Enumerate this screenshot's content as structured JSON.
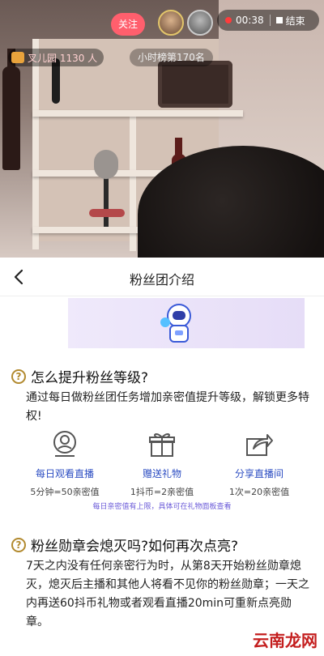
{
  "live": {
    "follow_label": "关注",
    "rec_time": "00:38",
    "end_label": "结束",
    "fan_club_count": "叉儿园 1130 人",
    "hour_rank": "小时榜第170名"
  },
  "sheet": {
    "title": "粉丝团介绍",
    "section1": {
      "q_mark": "?",
      "title": "怎么提升粉丝等级?",
      "body": "通过每日做粉丝团任务增加亲密值提升等级，解锁更多特权!"
    },
    "features": [
      {
        "name": "每日观看直播",
        "desc": "5分钟=50亲密值"
      },
      {
        "name": "赠送礼物",
        "desc": "1抖币=2亲密值"
      },
      {
        "name": "分享直播间",
        "desc": "1次=20亲密值"
      }
    ],
    "note": "每日亲密值有上限，具体可在礼物面板查看",
    "section2": {
      "q_mark": "?",
      "title": "粉丝勋章会熄灭吗?如何再次点亮?",
      "body": "7天之内没有任何亲密行为时，从第8天开始粉丝勋章熄灭，熄灭后主播和其他人将看不见你的粉丝勋章；一天之内再送60抖币礼物或者观看直播20min可重新点亮勋章。"
    }
  },
  "watermark": "云南龙网",
  "colors": {
    "accent": "#ff5f6d",
    "feature_blue": "#2b4cc2",
    "note_purple": "#6b5bd8",
    "question_gold": "#b28a2f"
  }
}
